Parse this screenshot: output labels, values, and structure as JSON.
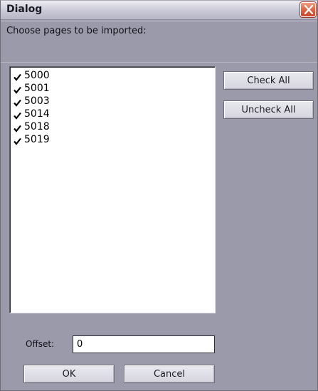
{
  "dialog": {
    "title": "Dialog",
    "prompt": "Choose pages to be imported:"
  },
  "pages": {
    "items": [
      {
        "label": "5000",
        "checked": true
      },
      {
        "label": "5001",
        "checked": true
      },
      {
        "label": "5003",
        "checked": true
      },
      {
        "label": "5014",
        "checked": true
      },
      {
        "label": "5018",
        "checked": true
      },
      {
        "label": "5019",
        "checked": true
      }
    ]
  },
  "buttons": {
    "check_all": "Check All",
    "uncheck_all": "Uncheck All",
    "ok": "OK",
    "cancel": "Cancel"
  },
  "offset": {
    "label": "Offset:",
    "value": "0"
  },
  "colors": {
    "window_bg": "#9b9aaa",
    "close_button": "#e06a4a"
  },
  "icons": {
    "close": "close-icon",
    "check": "check-icon"
  }
}
